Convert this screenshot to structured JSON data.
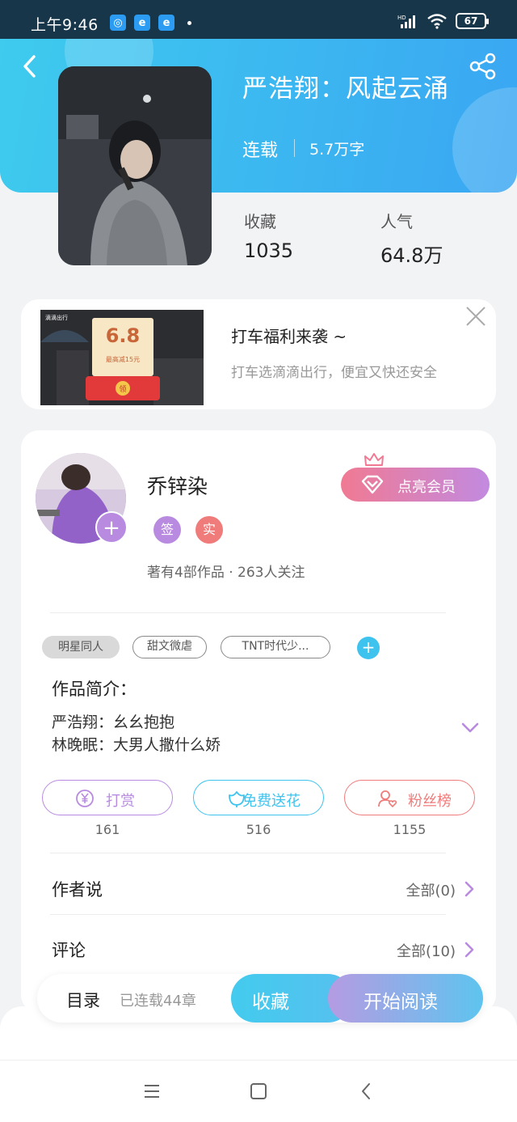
{
  "status_bar": {
    "time": "上午9:46",
    "apps": [
      "app-icon",
      "ie-icon",
      "ie-icon"
    ],
    "battery": "67"
  },
  "book": {
    "title": "严浩翔：风起云涌",
    "status": "连载",
    "word_count": "5.7万字",
    "stats": [
      {
        "label": "收藏",
        "value": "1035"
      },
      {
        "label": "人气",
        "value": "64.8万"
      }
    ]
  },
  "ad": {
    "title": "打车福利来袭 ~",
    "subtitle": "打车选滴滴出行，便宜又快还安全",
    "image": {
      "brand": "滴滴出行",
      "price": "6.8",
      "note": "最高减15元",
      "claim": "领"
    }
  },
  "author": {
    "name": "乔锌染",
    "badges": [
      "签",
      "实"
    ],
    "meta": "著有4部作品 · 263人关注",
    "vip_label": "点亮会员"
  },
  "tags": [
    "明星同人",
    "甜文微虐",
    "TNT时代少..."
  ],
  "intro": {
    "title": "作品简介：",
    "lines": [
      "严浩翔：幺幺抱抱",
      "林晚眠：大男人撒什么娇"
    ]
  },
  "actions": [
    {
      "label": "打赏",
      "count": "161",
      "icon": "yen-icon",
      "color": "#b98be0"
    },
    {
      "label": "免费送花",
      "count": "516",
      "icon": "flower-icon",
      "color": "#3ec3ee"
    },
    {
      "label": "粉丝榜",
      "count": "1155",
      "icon": "fans-icon",
      "color": "#ef7b7b"
    }
  ],
  "rows": [
    {
      "title": "作者说",
      "right": "全部(0)"
    },
    {
      "title": "评论",
      "right": "全部(10)"
    }
  ],
  "bottom_bar": {
    "toc": "目录",
    "chapters": "已连载44章",
    "favorite": "收藏",
    "read": "开始阅读"
  },
  "colors": {
    "header_start": "#3ecbee",
    "header_end": "#3aa6f2",
    "accent_purple": "#b98be0",
    "accent_blue": "#3ec3ee",
    "accent_red": "#ef7b7b"
  }
}
